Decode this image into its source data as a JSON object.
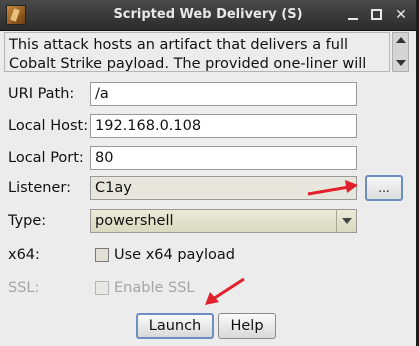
{
  "window": {
    "title": "Scripted Web Delivery (S)",
    "title_icon": "app-icon",
    "minimize_icon": "minimize-icon",
    "maximize_icon": "maximize-icon",
    "close_icon": "close-icon",
    "close_glyph": "✕"
  },
  "description": {
    "text": "This attack hosts an artifact that delivers a full Cobalt Strike payload. The provided one-liner will allow you to"
  },
  "form": {
    "uri_path": {
      "label": "URI Path:",
      "value": "/a"
    },
    "local_host": {
      "label": "Local Host:",
      "value": "192.168.0.108"
    },
    "local_port": {
      "label": "Local Port:",
      "value": "80"
    },
    "listener": {
      "label": "Listener:",
      "value": "C1ay",
      "button_label": "..."
    },
    "type": {
      "label": "Type:",
      "value": "powershell"
    },
    "x64": {
      "label": "x64:",
      "checkbox_label": "Use x64 payload",
      "checked": false
    },
    "ssl": {
      "label": "SSL:",
      "checkbox_label": "Enable SSL",
      "checked": false,
      "enabled": false
    }
  },
  "buttons": {
    "launch": "Launch",
    "help": "Help"
  },
  "colors": {
    "annotation_arrow": "#e0202a",
    "focus_border": "#6d8fbf"
  }
}
